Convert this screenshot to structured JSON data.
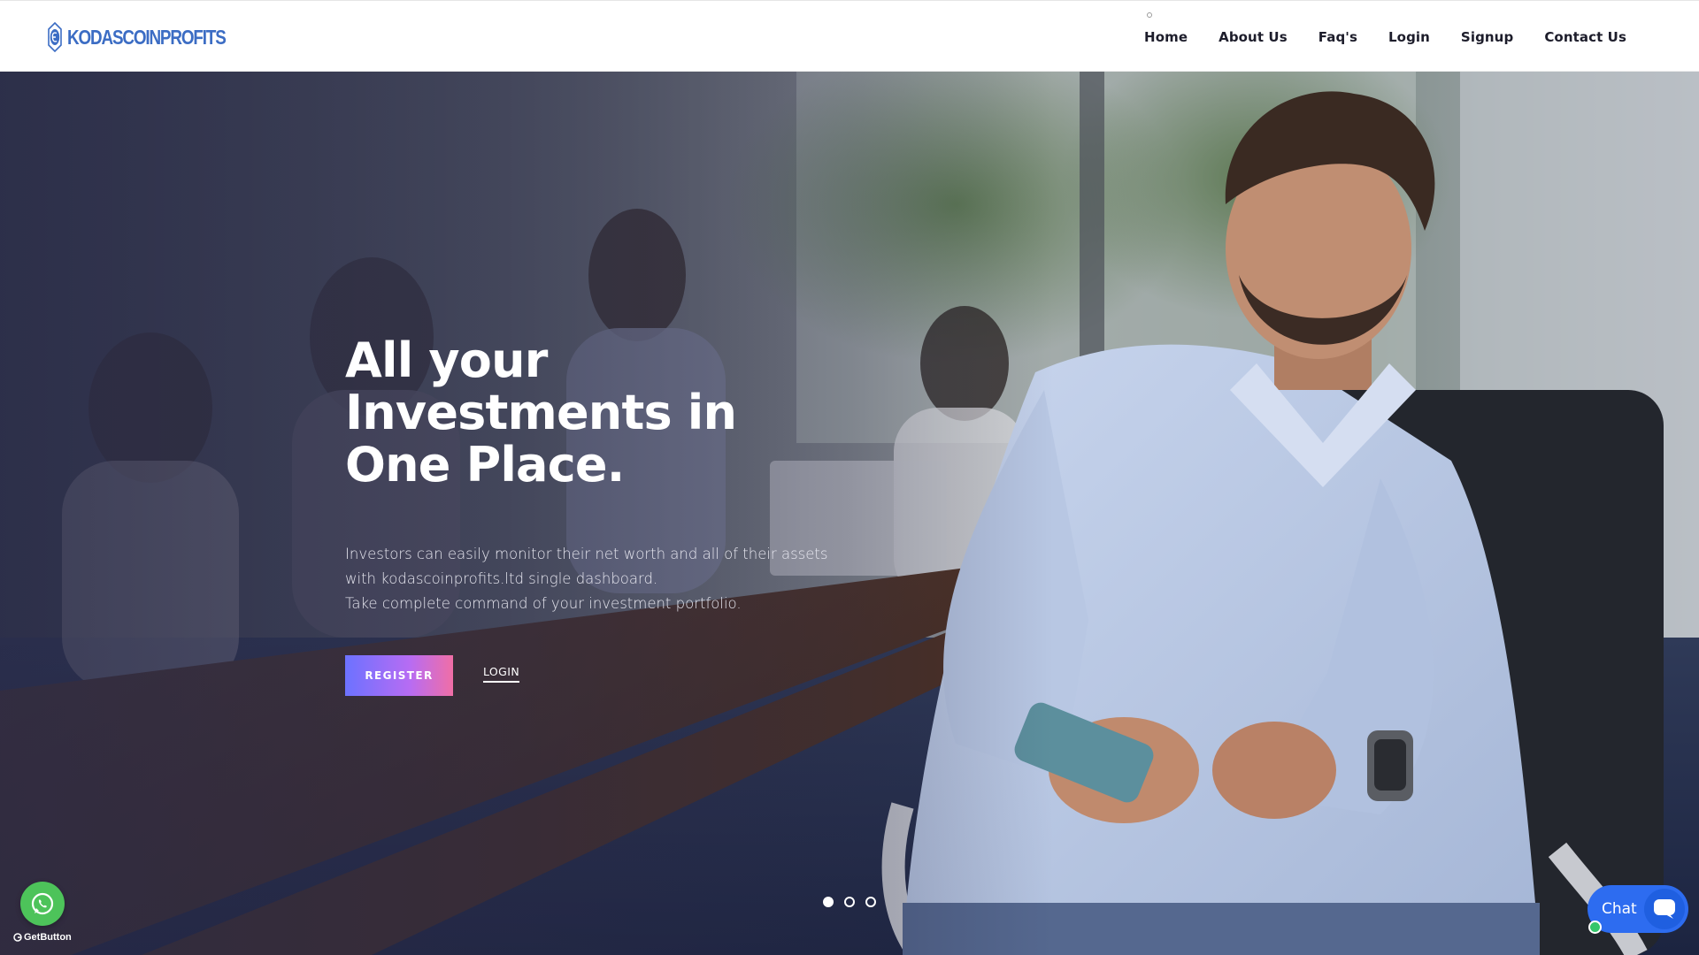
{
  "brand": {
    "name": "KODASCOINPROFITS",
    "color": "#3c6dc4"
  },
  "nav": {
    "items": [
      {
        "label": "Home"
      },
      {
        "label": "About Us"
      },
      {
        "label": "Faq's"
      },
      {
        "label": "Login"
      },
      {
        "label": "Signup"
      },
      {
        "label": "Contact Us"
      }
    ]
  },
  "hero": {
    "title": "All your Investments in One Place.",
    "description_line1": "Investors can easily monitor their net worth and all of their assets with kodascoinprofits.ltd single dashboard.",
    "description_line2": "Take complete command of your investment portfolio.",
    "register_label": "REGISTER",
    "login_label": "LOGIN",
    "carousel": {
      "slides": 3,
      "active_slide": 1
    }
  },
  "widgets": {
    "whatsapp_icon": "whatsapp-icon",
    "getbutton_label": "GetButton",
    "chat_label": "Chat",
    "chat_icon": "chat-bubble-icon"
  },
  "colors": {
    "accent_gradient": [
      "#6c72ff",
      "#b76cf3",
      "#f06ea6"
    ],
    "whatsapp": "#4dc35a",
    "chat": "#2d6cf0",
    "online": "#34c66b"
  }
}
